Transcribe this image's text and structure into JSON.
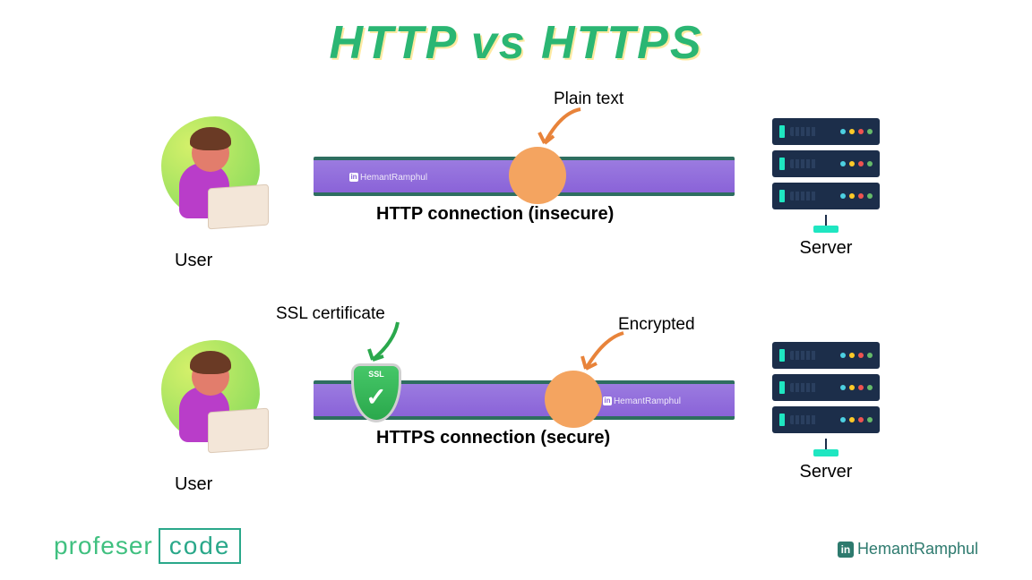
{
  "title": "HTTP vs HTTPS",
  "rows": {
    "http": {
      "user_label": "User",
      "server_label": "Server",
      "conn_label": "HTTP connection (insecure)",
      "circle_annot": "Plain text",
      "watermark": "HemantRamphul"
    },
    "https": {
      "user_label": "User",
      "server_label": "Server",
      "conn_label": "HTTPS connection (secure)",
      "circle_annot": "Encrypted",
      "ssl_annot": "SSL certificate",
      "ssl_badge_text": "SSL",
      "watermark": "HemantRamphul"
    }
  },
  "footer": {
    "brand_left_a": "profeser",
    "brand_left_b": "code",
    "brand_right": "HemantRamphul",
    "linkedin_glyph": "in"
  },
  "colors": {
    "title": "#2bb673",
    "bar": "#8a63d8",
    "bar_edge": "#2e6e60",
    "circle": "#f4a460",
    "server": "#1c2e4a",
    "accent": "#1fe6c1",
    "ssl": "#2aa84c",
    "arrow_orange": "#e8833a",
    "arrow_green": "#2aa84c"
  }
}
